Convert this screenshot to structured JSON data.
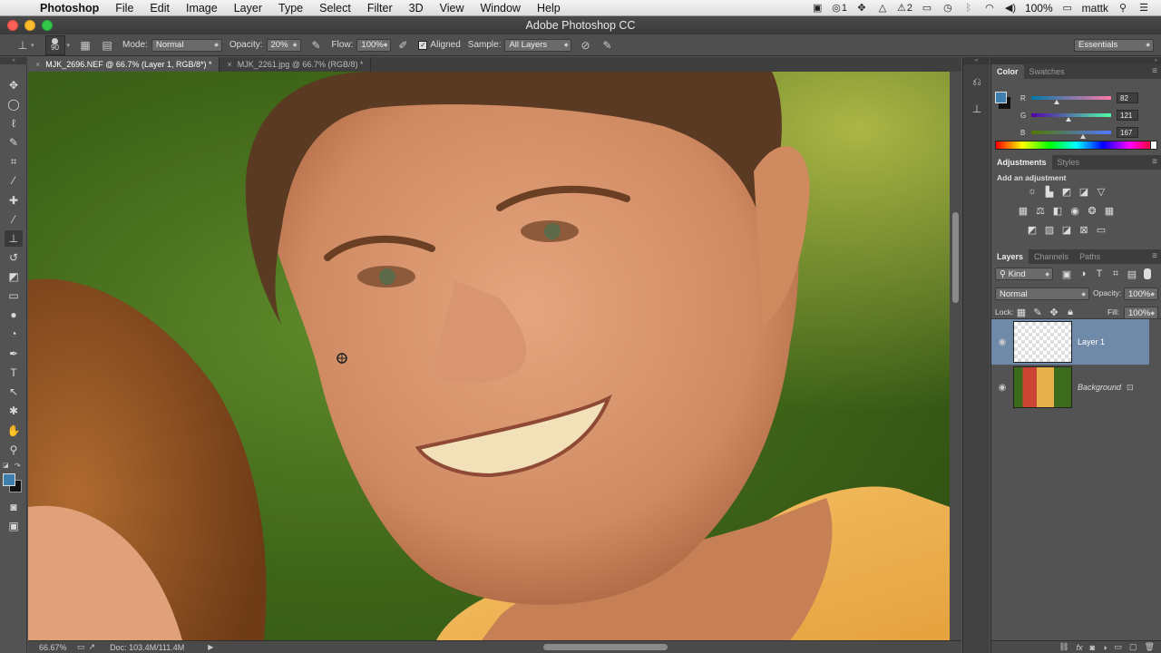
{
  "menubar": {
    "app": "Photoshop",
    "items": [
      "File",
      "Edit",
      "Image",
      "Layer",
      "Type",
      "Select",
      "Filter",
      "3D",
      "View",
      "Window",
      "Help"
    ],
    "notifications": "1",
    "dock_badge": "2",
    "battery": "100%",
    "user": "mattk"
  },
  "window": {
    "title": "Adobe Photoshop CC"
  },
  "options": {
    "brush_size": "90",
    "mode_label": "Mode:",
    "mode_value": "Normal",
    "opacity_label": "Opacity:",
    "opacity_value": "20%",
    "flow_label": "Flow:",
    "flow_value": "100%",
    "aligned_label": "Aligned",
    "sample_label": "Sample:",
    "sample_value": "All Layers",
    "workspace": "Essentials"
  },
  "tabs": [
    {
      "label": "MJK_2696.NEF @ 66.7% (Layer 1, RGB/8*) *"
    },
    {
      "label": "MJK_2261.jpg @ 66.7% (RGB/8) *"
    }
  ],
  "status": {
    "zoom": "66.67%",
    "doc": "Doc: 103.4M/111.4M"
  },
  "color_panel": {
    "tabs": [
      "Color",
      "Swatches"
    ],
    "foreground": "#3f7fae",
    "channels": [
      {
        "name": "R",
        "value": "82",
        "fraction": 0.32
      },
      {
        "name": "G",
        "value": "121",
        "fraction": 0.47
      },
      {
        "name": "B",
        "value": "167",
        "fraction": 0.65
      }
    ]
  },
  "adjustments_panel": {
    "tabs": [
      "Adjustments",
      "Styles"
    ],
    "heading": "Add an adjustment",
    "icons": [
      [
        "brightness-icon",
        "levels-icon",
        "curves-icon",
        "exposure-icon",
        "vibrance-icon"
      ],
      [
        "hue-saturation-icon",
        "color-balance-icon",
        "black-white-icon",
        "photo-filter-icon",
        "channel-mixer-icon",
        "color-lookup-icon"
      ],
      [
        "invert-icon",
        "posterize-icon",
        "threshold-icon",
        "selective-color-icon",
        "gradient-map-icon"
      ]
    ]
  },
  "layers_panel": {
    "tabs": [
      "Layers",
      "Channels",
      "Paths"
    ],
    "filter": "Kind",
    "blend_mode": "Normal",
    "opacity_label": "Opacity:",
    "opacity_value": "100%",
    "lock_label": "Lock:",
    "fill_label": "Fill:",
    "fill_value": "100%",
    "layers": [
      {
        "name": "Layer 1",
        "selected": true
      },
      {
        "name": "Background",
        "selected": false
      }
    ]
  }
}
